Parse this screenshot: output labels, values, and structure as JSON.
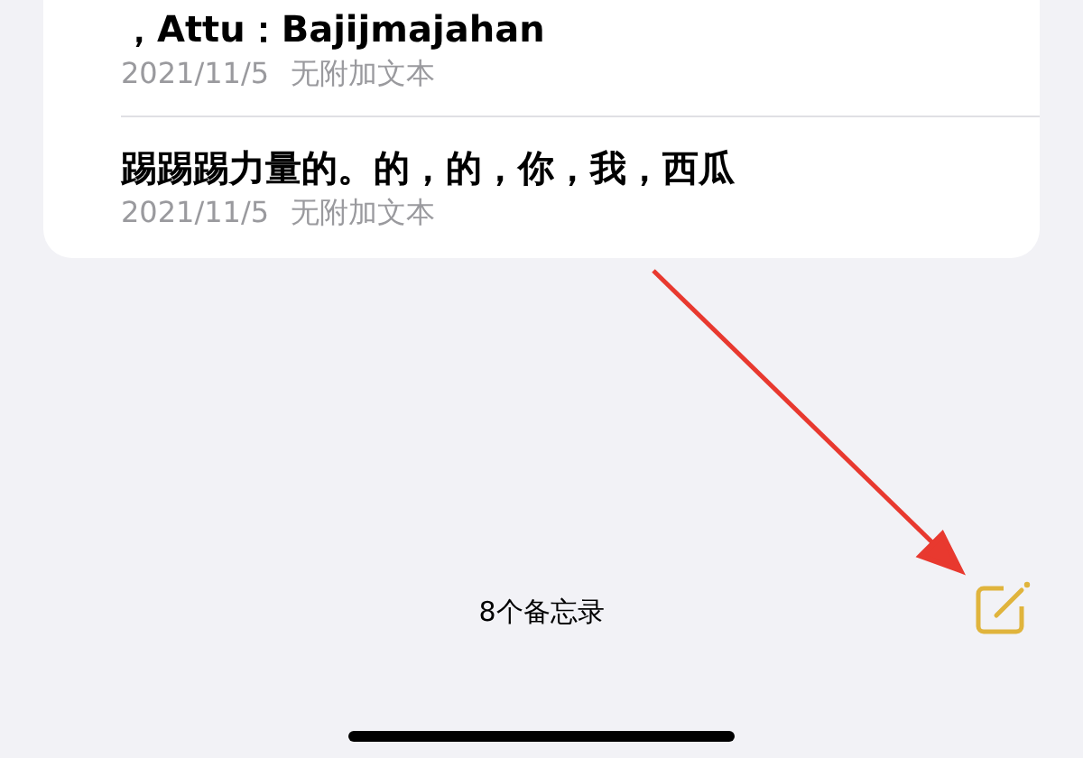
{
  "notes": [
    {
      "title": "，Attu：Bajijmajahan",
      "date": "2021/11/5",
      "preview": "无附加文本"
    },
    {
      "title": "踢踢踢力量的。的，的，你，我，西瓜",
      "date": "2021/11/5",
      "preview": "无附加文本"
    }
  ],
  "toolbar": {
    "count": "8个备忘录"
  }
}
